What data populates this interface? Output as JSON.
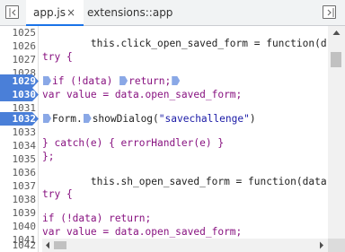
{
  "tabs": {
    "active": {
      "label": "app.js",
      "close": "×"
    },
    "inactive": {
      "label": "extensions::app"
    }
  },
  "gutter": [
    {
      "n": "1025",
      "bp": false
    },
    {
      "n": "1026",
      "bp": false
    },
    {
      "n": "1027",
      "bp": false
    },
    {
      "n": "1028",
      "bp": false
    },
    {
      "n": "1029",
      "bp": true
    },
    {
      "n": "1030",
      "bp": true
    },
    {
      "n": "1031",
      "bp": false
    },
    {
      "n": "1032",
      "bp": true
    },
    {
      "n": "1033",
      "bp": false
    },
    {
      "n": "1034",
      "bp": false
    },
    {
      "n": "1035",
      "bp": false
    },
    {
      "n": "1036",
      "bp": false
    },
    {
      "n": "1037",
      "bp": false
    },
    {
      "n": "1038",
      "bp": false
    },
    {
      "n": "1039",
      "bp": false
    },
    {
      "n": "1040",
      "bp": false
    },
    {
      "n": "1041",
      "bp": false
    },
    {
      "n": "1042",
      "bp": false
    }
  ],
  "code": {
    "l1026": "        this.click_open_saved_form = function(dat",
    "l1027": "try {",
    "l1029_a": "if (!data) ",
    "l1029_b": "return;",
    "l1030": "var value = data.open_saved_form;",
    "l1032_a": "Form.",
    "l1032_b": "showDialog(",
    "l1032_c": "\"savechallenge\"",
    "l1032_d": ")",
    "l1034": "} catch(e) { errorHandler(e) }",
    "l1035": "};",
    "l1037": "        this.sh_open_saved_form = function(data,",
    "l1038": "try {",
    "l1040": "if (!data) return;",
    "l1041": "var value = data.open_saved_form;"
  },
  "icons": {
    "left": "sidebar-toggle-left-icon",
    "right": "sidebar-toggle-right-icon",
    "scroll_up": "scroll-up-arrow-icon",
    "scroll_left": "scroll-left-arrow-icon",
    "scroll_right": "scroll-right-arrow-icon"
  },
  "colors": {
    "breakpoint": "#4a7fd8",
    "inline_breakpoint": "#8aa8e6",
    "active_tab_underline": "#1a73e8",
    "keyword": "#881280",
    "string": "#1a1aa6"
  }
}
